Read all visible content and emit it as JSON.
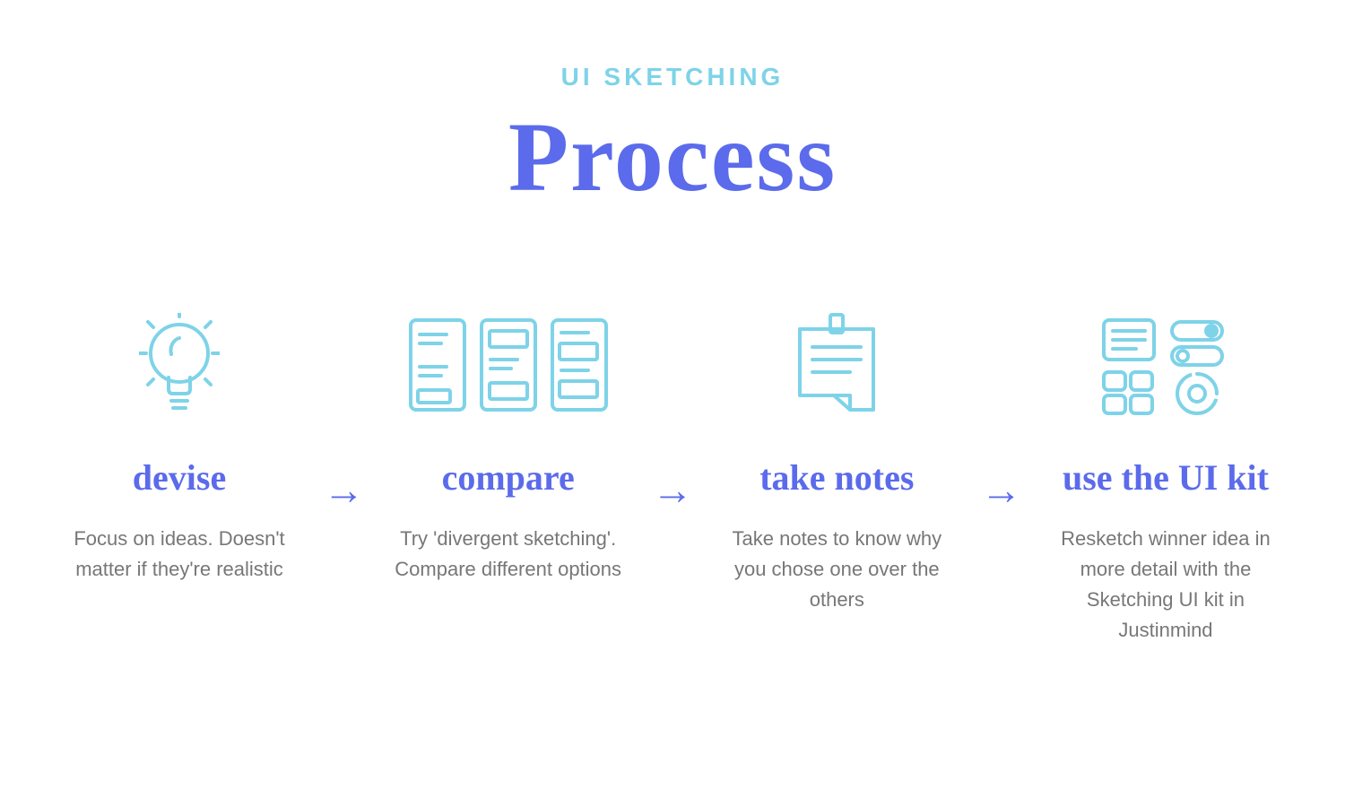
{
  "header": {
    "eyebrow": "UI SKETCHING",
    "title": "Process"
  },
  "steps": [
    {
      "heading": "devise",
      "description": "Focus on ideas. Doesn't matter if they're realistic",
      "icon": "lightbulb-icon"
    },
    {
      "heading": "compare",
      "description": "Try 'divergent sketching'. Compare different options",
      "icon": "wireframes-icon"
    },
    {
      "heading": "take notes",
      "description": "Take notes to know why you chose one over the others",
      "icon": "note-icon"
    },
    {
      "heading": "use the UI kit",
      "description": "Resketch winner idea in more detail with the Sketching UI kit in Justinmind",
      "icon": "ui-kit-icon"
    }
  ],
  "icon_color": "#7ED3E8",
  "arrow_glyph": "→"
}
